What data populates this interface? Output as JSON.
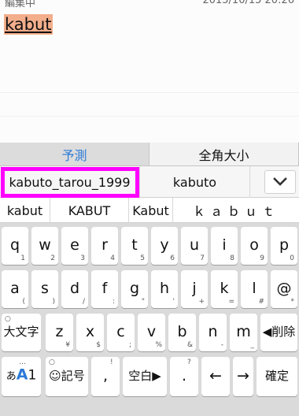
{
  "editor": {
    "status_left": "編集中",
    "status_right": "2015/10/15 20:26",
    "text": "kabut"
  },
  "keyboard": {
    "tabs": [
      "予測",
      "全角大小"
    ],
    "candidates": [
      "kabuto_tarou_1999",
      "kabuto"
    ],
    "expand_icon": "chevron-down-icon",
    "conversions": [
      "kabut",
      "KABUT",
      "Kabut",
      "ｋａｂｕｔ"
    ],
    "row1": [
      {
        "key": "q",
        "sub": "1"
      },
      {
        "key": "w",
        "sub": "2"
      },
      {
        "key": "e",
        "sub": "3"
      },
      {
        "key": "r",
        "sub": "4"
      },
      {
        "key": "t",
        "sub": "5"
      },
      {
        "key": "y",
        "sub": "6"
      },
      {
        "key": "u",
        "sub": "7"
      },
      {
        "key": "i",
        "sub": "8"
      },
      {
        "key": "o",
        "sub": "9"
      },
      {
        "key": "p",
        "sub": "0"
      }
    ],
    "row2": [
      {
        "key": "a",
        "sub": "("
      },
      {
        "key": "s",
        "sub": ")"
      },
      {
        "key": "d",
        "sub": "/"
      },
      {
        "key": "f",
        "sub": ":"
      },
      {
        "key": "g",
        "sub": "\""
      },
      {
        "key": "h",
        "sub": "'"
      },
      {
        "key": "j",
        "sub": "+"
      },
      {
        "key": "k",
        "sub": "="
      },
      {
        "key": "l",
        "sub": "#"
      },
      {
        "key": "@",
        "sub": "*"
      }
    ],
    "row3": {
      "shift": {
        "label": "大文字",
        "top": "○"
      },
      "keys": [
        {
          "key": "z",
          "sub": "¥"
        },
        {
          "key": "x",
          "sub": "$"
        },
        {
          "key": "c",
          "sub": ";"
        },
        {
          "key": "v",
          "sub": "%"
        },
        {
          "key": "b",
          "sub": "&"
        },
        {
          "key": "n",
          "sub": "-"
        },
        {
          "key": "m",
          "sub": "_"
        }
      ],
      "delete": "◀削除"
    },
    "row4": {
      "mode": {
        "label_small": "あ",
        "label_big": "A",
        "label_num": "1",
        "top": "…"
      },
      "symbols": {
        "label": "☺記号",
        "top": "○"
      },
      "comma": {
        "label": ",",
        "top": "!"
      },
      "space": "空白▶",
      "period": {
        "label": ".",
        "top": "?"
      },
      "left": "←",
      "right": "→",
      "enter": "確定"
    }
  }
}
